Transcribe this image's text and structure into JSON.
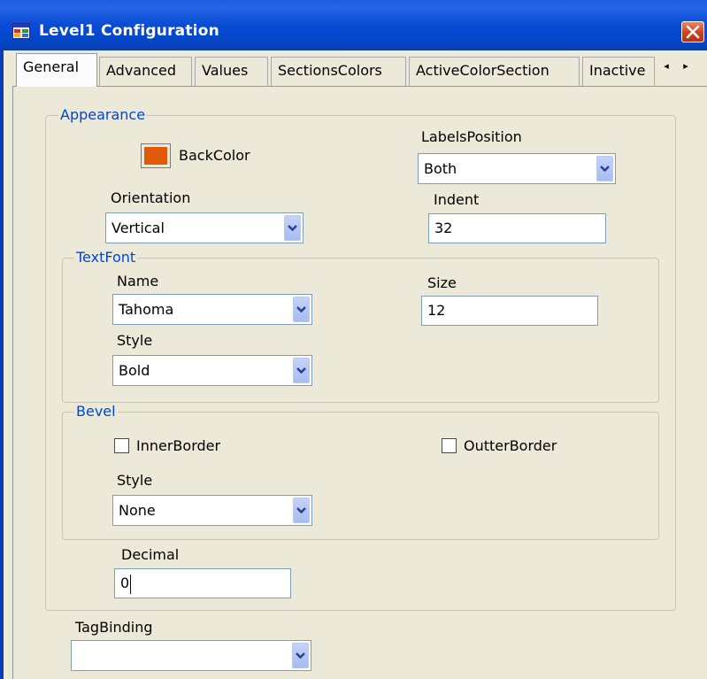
{
  "window": {
    "title": "Level1 Configuration"
  },
  "tabs": [
    "General",
    "Advanced",
    "Values",
    "SectionsColors",
    "ActiveColorSection",
    "Inactive"
  ],
  "tab_scroll": {
    "left": "◂",
    "right": "▸"
  },
  "appearance": {
    "legend": "Appearance",
    "backcolor_label": "BackColor",
    "backcolor": "#e05a0c",
    "labels_position_label": "LabelsPosition",
    "labels_position": "Both",
    "orientation_label": "Orientation",
    "orientation": "Vertical",
    "indent_label": "Indent",
    "indent": "32"
  },
  "textfont": {
    "legend": "TextFont",
    "name_label": "Name",
    "name": "Tahoma",
    "size_label": "Size",
    "size": "12",
    "style_label": "Style",
    "style": "Bold"
  },
  "bevel": {
    "legend": "Bevel",
    "inner_border_label": "InnerBorder",
    "outter_border_label": "OutterBorder",
    "style_label": "Style",
    "style": "None"
  },
  "decimal": {
    "label": "Decimal",
    "value": "0"
  },
  "tag_binding": {
    "label": "TagBinding",
    "value": ""
  }
}
